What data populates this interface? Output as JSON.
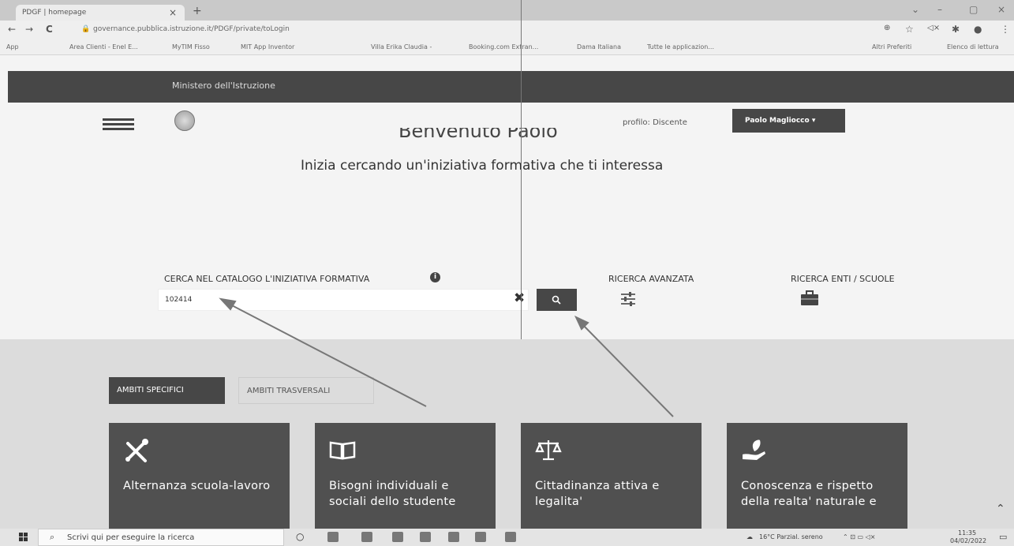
{
  "browser": {
    "tab_title": "PDGF | homepage",
    "url": "governance.pubblica.istruzione.it/PDGF/private/toLogin",
    "bookmarks": [
      "App",
      "Area Clienti - Enel E...",
      "MyTIM Fisso",
      "MIT App Inventor",
      "Villa Erika Claudia -",
      "Booking.com Extran...",
      "Dama Italiana",
      "Tutte le applicazion..."
    ],
    "bookmarks_right": [
      "Altri Preferiti",
      "Elenco di lettura"
    ]
  },
  "site": {
    "ministry": "Ministero dell'Istruzione",
    "profile": "profilo: Discente",
    "user": "Paolo Magliocco",
    "title_cut": "Benvenuto Paolo",
    "subtitle": "Inizia cercando un'iniziativa formativa che ti interessa"
  },
  "search": {
    "label": "CERCA NEL CATALOGO L'INIZIATIVA FORMATIVA",
    "value": "102414",
    "advanced_label": "RICERCA AVANZATA",
    "entities_label": "RICERCA ENTI / SCUOLE"
  },
  "tabs": [
    "AMBITI SPECIFICI",
    "AMBITI TRASVERSALI"
  ],
  "cards": [
    {
      "title": "Alternanza scuola-lavoro",
      "icon": "tools-icon"
    },
    {
      "title": "Bisogni individuali e sociali dello studente",
      "icon": "book-icon"
    },
    {
      "title": "Cittadinanza attiva e legalita'",
      "icon": "scales-icon"
    },
    {
      "title": "Conoscenza e rispetto della realta' naturale e",
      "icon": "plant-hand-icon"
    }
  ],
  "taskbar": {
    "search_placeholder": "Scrivi qui per eseguire la ricerca",
    "weather": "16°C  Parzial. sereno",
    "time": "11:35",
    "date": "04/02/2022"
  },
  "colors": {
    "dark_bar": "#474747",
    "card": "#505050",
    "page_bg": "#f4f4f4"
  }
}
